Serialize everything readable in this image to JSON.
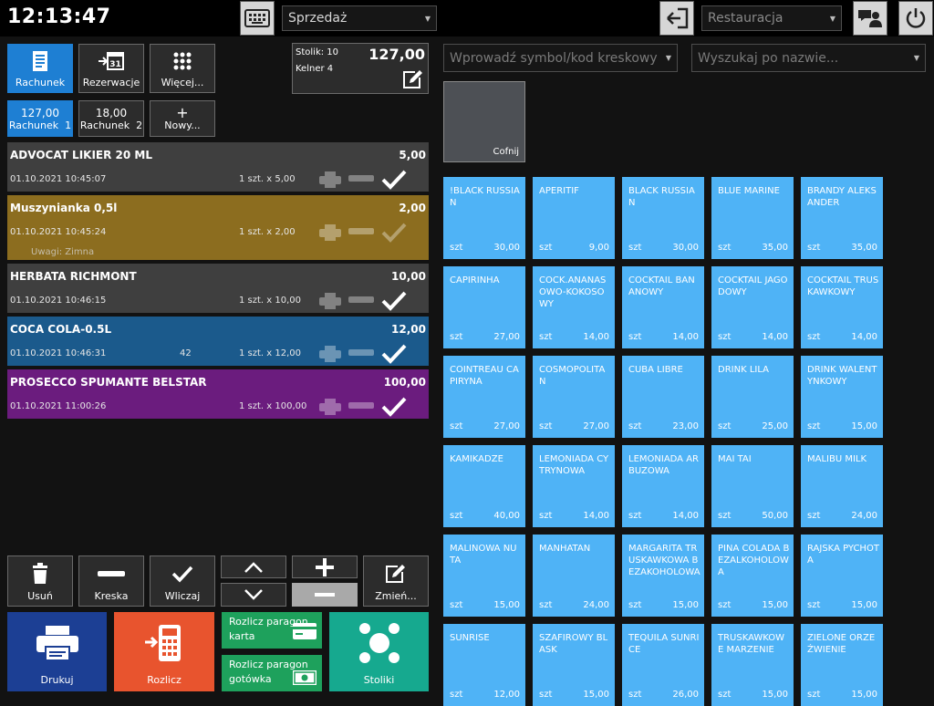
{
  "topbar": {
    "time": "12:13:47",
    "mode_dropdown": "Sprzedaż",
    "location_dropdown": "Restauracja"
  },
  "left_buttons": {
    "rachunek": "Rachunek",
    "rezerwacje": "Rezerwacje",
    "wiecej": "Więcej..."
  },
  "bills": [
    {
      "amount": "127,00",
      "label": "Rachunek",
      "num": "1"
    },
    {
      "amount": "18,00",
      "label": "Rachunek",
      "num": "2"
    }
  ],
  "new_bill": "Nowy...",
  "table_info": {
    "table": "Stolik: 10",
    "waiter": "Kelner 4",
    "total": "127,00"
  },
  "orders": [
    {
      "name": "ADVOCAT LIKIER 20 ML",
      "price": "5,00",
      "datetime": "01.10.2021 10:45:07",
      "extra": "",
      "qty": "1 szt. x 5,00",
      "note": "",
      "color": "#3f3f3f"
    },
    {
      "name": "Muszynianka 0,5l",
      "price": "2,00",
      "datetime": "01.10.2021 10:45:24",
      "extra": "",
      "qty": "1 szt. x 2,00",
      "note": "Uwagi: Zimna",
      "color": "#8c6d1f"
    },
    {
      "name": "HERBATA RICHMONT",
      "price": "10,00",
      "datetime": "01.10.2021 10:46:15",
      "extra": "",
      "qty": "1 szt. x 10,00",
      "note": "",
      "color": "#3f3f3f"
    },
    {
      "name": "COCA COLA-0.5L",
      "price": "12,00",
      "datetime": "01.10.2021 10:46:31",
      "extra": "42",
      "qty": "1 szt. x 12,00",
      "note": "",
      "color": "#1b5a8c"
    },
    {
      "name": "PROSECCO SPUMANTE BELSTAR",
      "price": "100,00",
      "datetime": "01.10.2021 11:00:26",
      "extra": "",
      "qty": "1 szt. x 100,00",
      "note": "",
      "color": "#6b1c7e"
    }
  ],
  "bottom_controls": {
    "usun": "Usuń",
    "kreska": "Kreska",
    "wliczaj": "Wliczaj",
    "zmien": "Zmień..."
  },
  "actions": {
    "drukuj": "Drukuj",
    "rozlicz": "Rozlicz",
    "paragon_karta": "Rozlicz paragon karta",
    "paragon_karta_l1": "Rozlicz paragon",
    "paragon_karta_l2": "karta",
    "paragon_gotowka_l1": "Rozlicz paragon",
    "paragon_gotowka_l2": "gotówka",
    "stoliki": "Stoliki"
  },
  "search": {
    "barcode_placeholder": "Wprowadź symbol/kod kreskowy",
    "name_placeholder": "Wyszukaj po nazwie..."
  },
  "back_button": "Cofnij",
  "products": [
    {
      "name": "!BLACK RUSSIAN",
      "unit": "szt",
      "price": "30,00"
    },
    {
      "name": "APERITIF",
      "unit": "szt",
      "price": "9,00"
    },
    {
      "name": "BLACK RUSSIAN",
      "unit": "szt",
      "price": "30,00"
    },
    {
      "name": "BLUE MARINE",
      "unit": "szt",
      "price": "35,00"
    },
    {
      "name": "BRANDY ALEKSANDER",
      "unit": "szt",
      "price": "35,00"
    },
    {
      "name": "CAPIRINHA",
      "unit": "szt",
      "price": "27,00"
    },
    {
      "name": "COCK.ANANASOWO-KOKOSOWY",
      "unit": "szt",
      "price": "14,00"
    },
    {
      "name": "COCKTAIL BANANOWY",
      "unit": "szt",
      "price": "14,00"
    },
    {
      "name": "COCKTAIL JAGODOWY",
      "unit": "szt",
      "price": "14,00"
    },
    {
      "name": "COCKTAIL TRUSKAWKOWY",
      "unit": "szt",
      "price": "14,00"
    },
    {
      "name": "COINTREAU CAPIRYNA",
      "unit": "szt",
      "price": "27,00"
    },
    {
      "name": "COSMOPOLITAN",
      "unit": "szt",
      "price": "27,00"
    },
    {
      "name": "CUBA LIBRE",
      "unit": "szt",
      "price": "23,00"
    },
    {
      "name": "DRINK LILA",
      "unit": "szt",
      "price": "25,00"
    },
    {
      "name": "DRINK WALENTYNKOWY",
      "unit": "szt",
      "price": "15,00"
    },
    {
      "name": "KAMIKADZE",
      "unit": "szt",
      "price": "40,00"
    },
    {
      "name": "LEMONIADA CYTRYNOWA",
      "unit": "szt",
      "price": "14,00"
    },
    {
      "name": "LEMONIADA ARBUZOWA",
      "unit": "szt",
      "price": "14,00"
    },
    {
      "name": "MAI TAI",
      "unit": "szt",
      "price": "50,00"
    },
    {
      "name": "MALIBU MILK",
      "unit": "szt",
      "price": "24,00"
    },
    {
      "name": "MALINOWA NUTA",
      "unit": "szt",
      "price": "15,00"
    },
    {
      "name": "MANHATAN",
      "unit": "szt",
      "price": "24,00"
    },
    {
      "name": "MARGARITA TRUSKAWKOWA BEZAKOHOLOWA",
      "unit": "szt",
      "price": "15,00"
    },
    {
      "name": "PINA COLADA BEZALKOHOLOWA",
      "unit": "szt",
      "price": "15,00"
    },
    {
      "name": "RAJSKA PYCHOTA",
      "unit": "szt",
      "price": "15,00"
    },
    {
      "name": "SUNRISE",
      "unit": "szt",
      "price": "12,00"
    },
    {
      "name": "SZAFIROWY BLASK",
      "unit": "szt",
      "price": "15,00"
    },
    {
      "name": "TEQUILA SUNRICE",
      "unit": "szt",
      "price": "26,00"
    },
    {
      "name": "TRUSKAWKOWE MARZENIE",
      "unit": "szt",
      "price": "15,00"
    },
    {
      "name": "ZIELONE ORZEŹWIENIE",
      "unit": "szt",
      "price": "15,00"
    }
  ],
  "colors": {
    "accent_blue": "#1e7fd3",
    "product_tile": "#4fb3f6",
    "print_button": "#1c3f94",
    "settle_button": "#e8542e",
    "green": "#1ea15c",
    "tables_button": "#16a98f"
  }
}
